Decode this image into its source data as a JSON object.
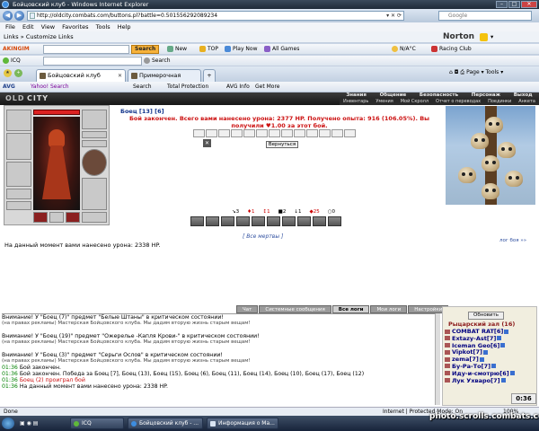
{
  "window": {
    "title": "Бойцовский клуб - Windows Internet Explorer",
    "min": "–",
    "max": "□",
    "close": "✕"
  },
  "address": {
    "url": "http://oldcity.combats.com/buttons.pl?battle=0.5015562920892​34",
    "search_placeholder": "Google"
  },
  "menu": [
    "File",
    "Edit",
    "View",
    "Favorites",
    "Tools",
    "Help"
  ],
  "links": {
    "label": "Links",
    "custom": "Customize Links",
    "norton": "Norton",
    "norton_dropdown": "▾"
  },
  "toolbar1": {
    "brand": "AKINGIM",
    "find": "Search",
    "new": "New",
    "top": "TOP",
    "play": "Play Now",
    "games": "All Games",
    "weather": "N/A°C",
    "racing": "Racing Club"
  },
  "toolbar2": {
    "icq": "ICQ",
    "search": "Search"
  },
  "tabs": [
    {
      "label": "Бойцовский клуб",
      "active": true
    },
    {
      "label": "Примерочная DarkClan",
      "active": false
    }
  ],
  "tab_tools": {
    "page": "Page",
    "tools": "Tools"
  },
  "avgbar": {
    "avg": "AVG",
    "yahoo": "Yahoo! Search",
    "search": "Search",
    "protection": "Total Protection",
    "info": "AVG Info",
    "more": "Get More"
  },
  "game": {
    "logo": "OLDCITY",
    "logo_parts": [
      "OLD",
      "CITY"
    ],
    "topnav1": [
      "Знания",
      "Общение",
      "Безопасность",
      "Персонаж",
      "Выход"
    ],
    "topnav2": [
      "Инвентарь",
      "Умения",
      "Мой Скролл",
      "Отчет о переводах",
      "Поединки",
      "Анкета"
    ],
    "fighter": "Боец [13] [6]",
    "fight_message": "Бой закончен. Всего вами нанесено урона: 2377 HP. Получено опыта: 916 (106.05%). Вы получили ♥1.00 за этот бой.",
    "back_button": "Вернуться",
    "effects": [
      "3",
      "1",
      "1",
      "2",
      "1",
      "25",
      "0"
    ],
    "all_dead": "[ Все мертвы ]",
    "battle_log": "лог боя »»",
    "damage_line": "На данный момент вами нанесено урона: 2338 HP.",
    "low_tabs": [
      {
        "label": "Чат",
        "active": false
      },
      {
        "label": "Системные сообщения",
        "active": false
      },
      {
        "label": "Все логи",
        "active": true
      },
      {
        "label": "Мои логи",
        "active": false
      },
      {
        "label": "Настройки",
        "active": false
      }
    ]
  },
  "chat": {
    "lines": [
      {
        "type": "warn",
        "text": "Внимание! У \"Боец (7)\" предмет \"Белые Штаны\" в критическом состоянии!"
      },
      {
        "type": "ad",
        "text": "(на правах рекламы) Мастерская Бойцовского клуба. Мы дадим вторую жизнь старым вещам!"
      },
      {
        "type": "blank",
        "text": ""
      },
      {
        "type": "warn",
        "text": "Внимание! У \"Боец (19)\" предмет \"Ожерелье -Капля Крови-\" в критическом состоянии!"
      },
      {
        "type": "ad",
        "text": "(на правах рекламы) Мастерская Бойцовского клуба. Мы дадим вторую жизнь старым вещам!"
      },
      {
        "type": "blank",
        "text": ""
      },
      {
        "type": "warn",
        "text": "Внимание! У \"Боец (3)\" предмет \"Серьги Ослов\" в критическом состоянии!"
      },
      {
        "type": "ad",
        "text": "(на правах рекламы) Мастерская Бойцовского клуба. Мы дадим вторую жизнь старым вещам!"
      },
      {
        "type": "log",
        "time": "01:36",
        "text": "Бой закончен."
      },
      {
        "type": "log",
        "time": "01:36",
        "text": "Бой закончен. Победа за Боец [7], Боец (13), Боец (15), Боец (6), Боец (11), Боец (14), Боец (10), Боец (17), Боец (12)"
      },
      {
        "type": "logred",
        "time": "01:36",
        "text": "Боец (2) проиграл бой"
      },
      {
        "type": "log",
        "time": "01:36",
        "text": "На данный момент вами нанесено урона: 2338 HP."
      }
    ]
  },
  "userlist": {
    "refresh": "Обновить",
    "room": "Рыцарский зал (16)",
    "users": [
      "COMBAT RAT[6]",
      "Extazy-Ast[7]",
      "Iceman Geo[6]",
      "Vipkot[7]",
      "zema[7]",
      "Бу-Ра-То[7]",
      "Иду-и-смотрю[6]",
      "Лук Ухваро[7]"
    ]
  },
  "game_clock": "0:36",
  "status": {
    "left": "Done",
    "zone": "Internet | Protected Mode: On",
    "zoom": "100%"
  },
  "taskbar": [
    {
      "label": "ICQ"
    },
    {
      "label": "Бойцовский клуб - ..."
    },
    {
      "label": "Информация о Ма..."
    }
  ],
  "watermark": "photo.scrolls.combats.com",
  "colors": {
    "fight_message": "#cc1111",
    "chat_time": "#008000",
    "nick": "#000080",
    "room": "#8b1a1a"
  }
}
